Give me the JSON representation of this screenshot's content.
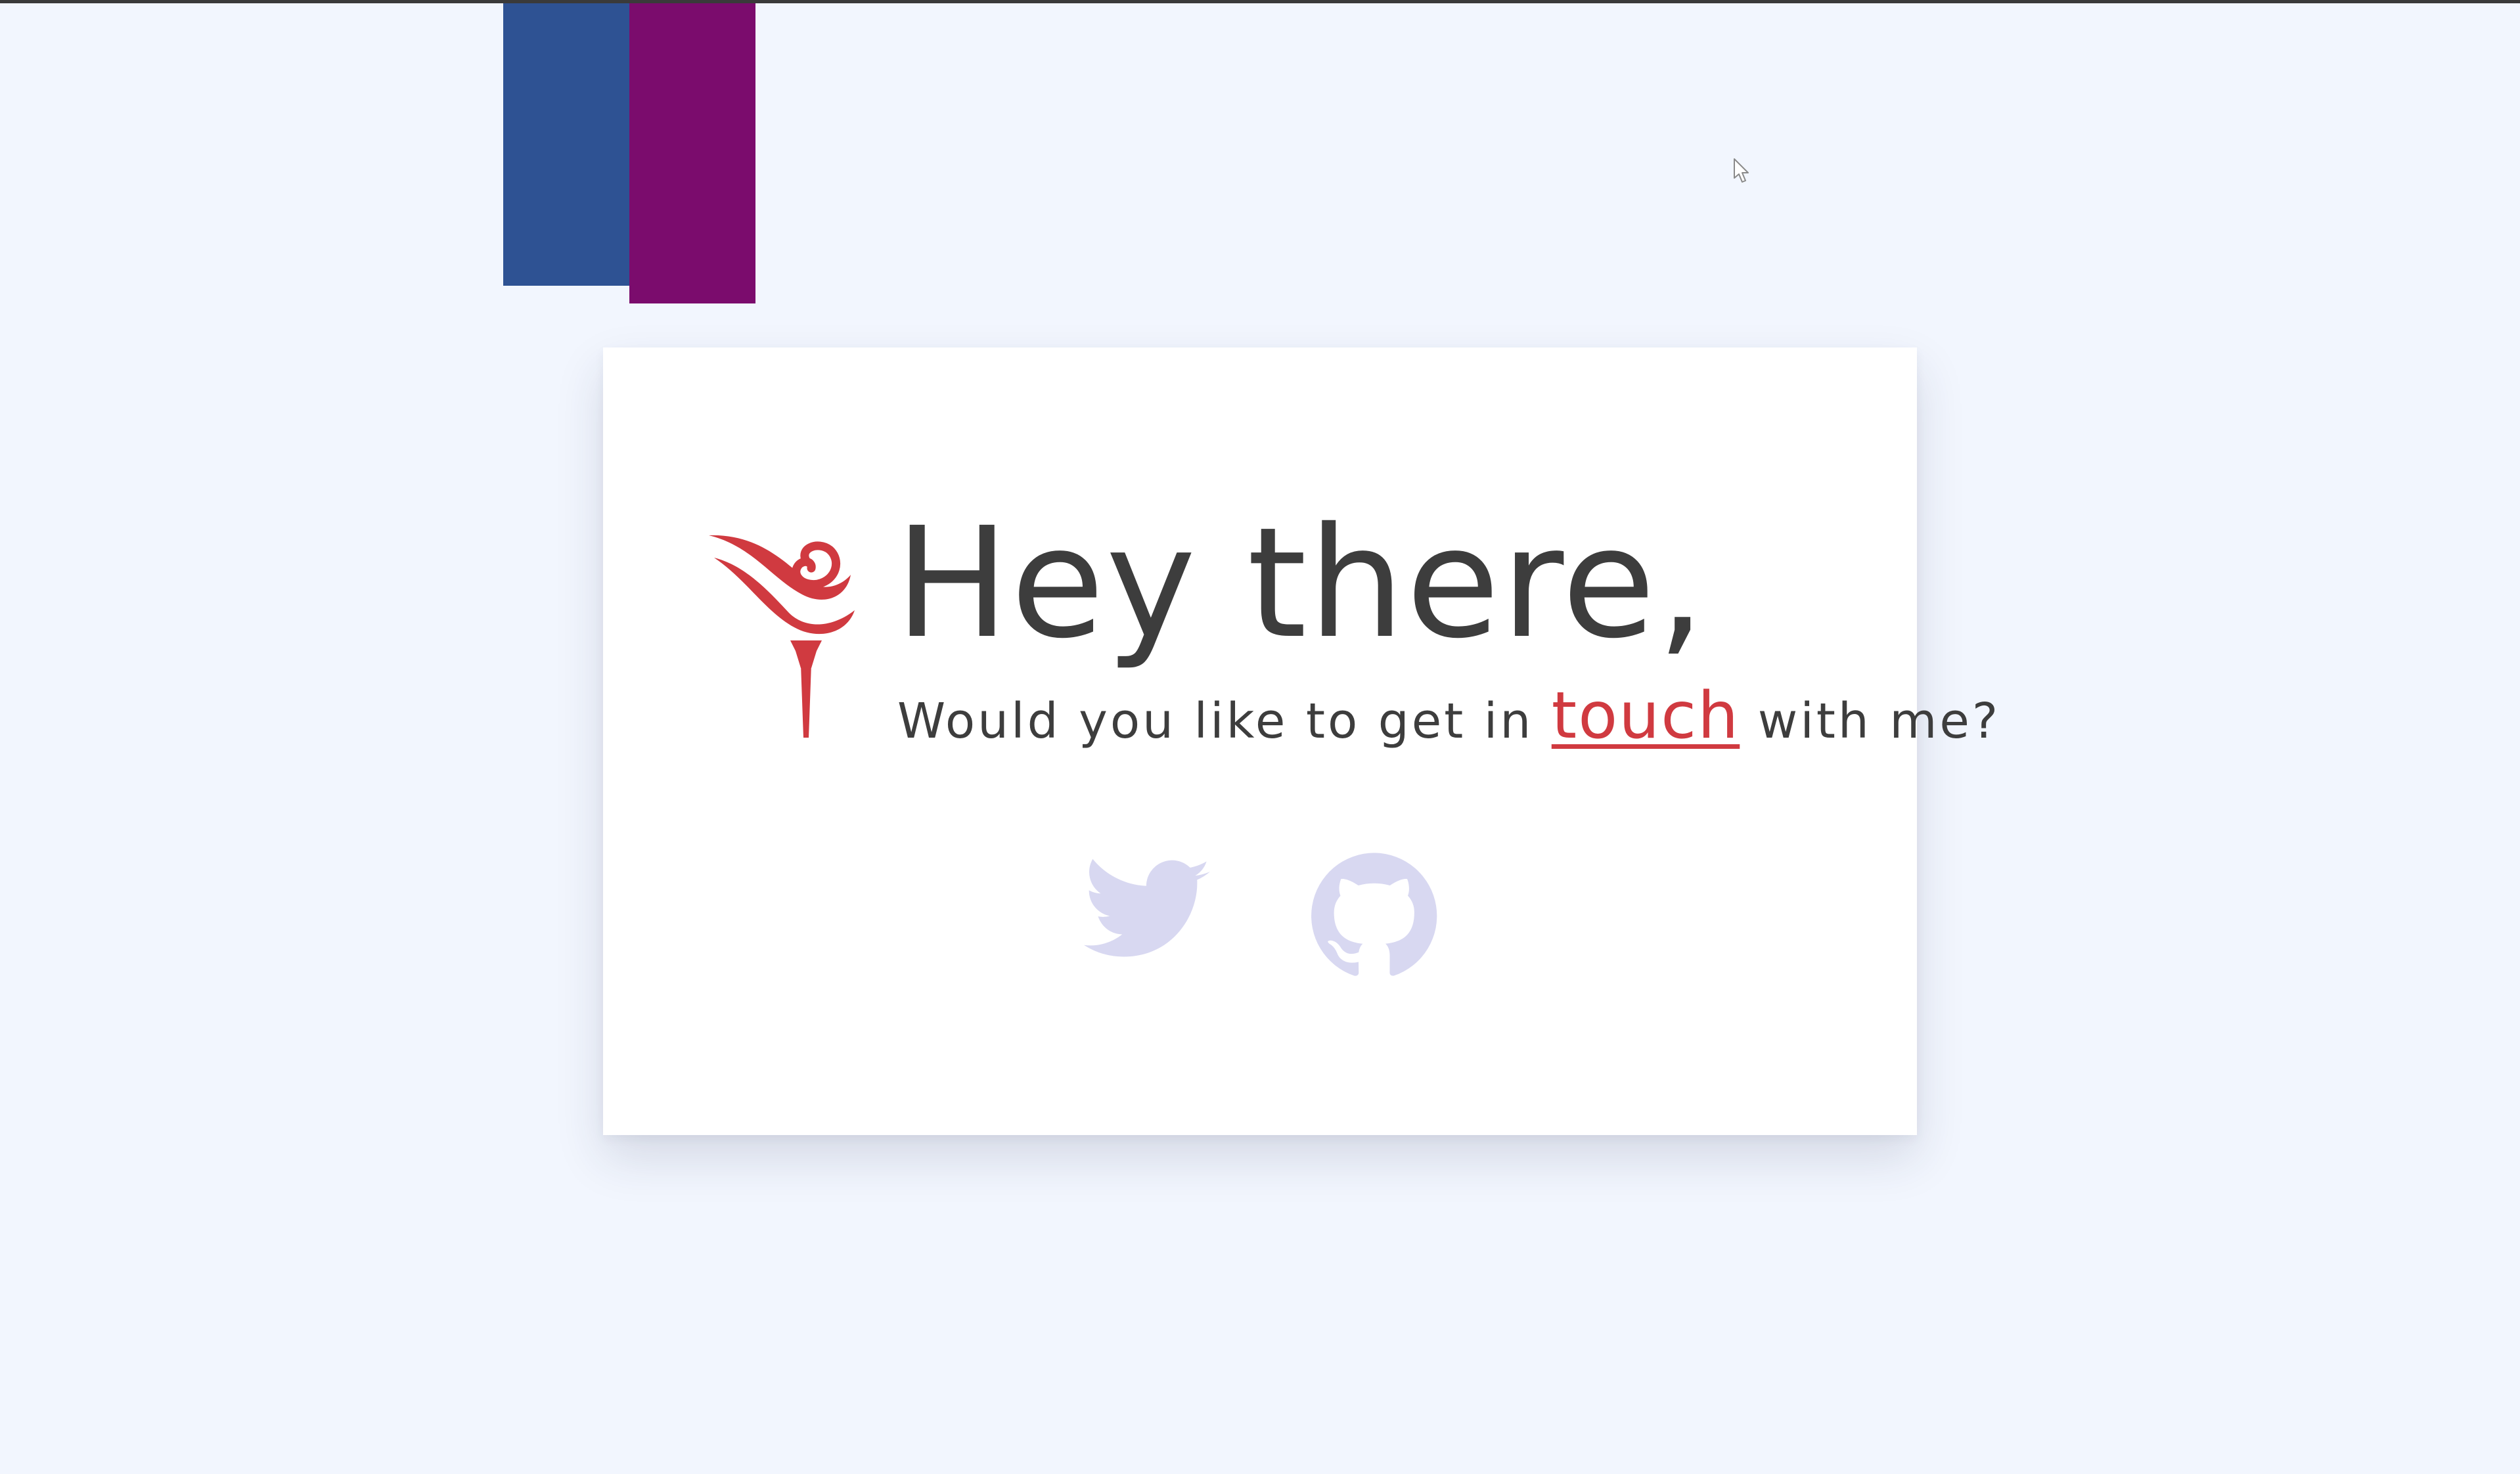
{
  "page": {
    "background_color": "#f2f6fe",
    "top_rule_color": "#3a3a3a"
  },
  "decoration": {
    "stripes": [
      {
        "name": "blue-stripe",
        "color": "#2e5293"
      },
      {
        "name": "purple-stripe",
        "color": "#7b0c6d"
      }
    ]
  },
  "card": {
    "logo_icon": "flame-logo-icon",
    "heading": "Hey there,",
    "subtitle_before": "Would you like to get in ",
    "subtitle_link": "touch",
    "subtitle_after": " with me?",
    "social_links": [
      {
        "icon": "twitter-bird-icon",
        "label": "Twitter"
      },
      {
        "icon": "github-octocat-icon",
        "label": "GitHub"
      }
    ]
  },
  "colors": {
    "text": "#3d3d3d",
    "accent": "#d03a40",
    "social_icon": "#d8d8f1",
    "card_background": "#ffffff"
  }
}
